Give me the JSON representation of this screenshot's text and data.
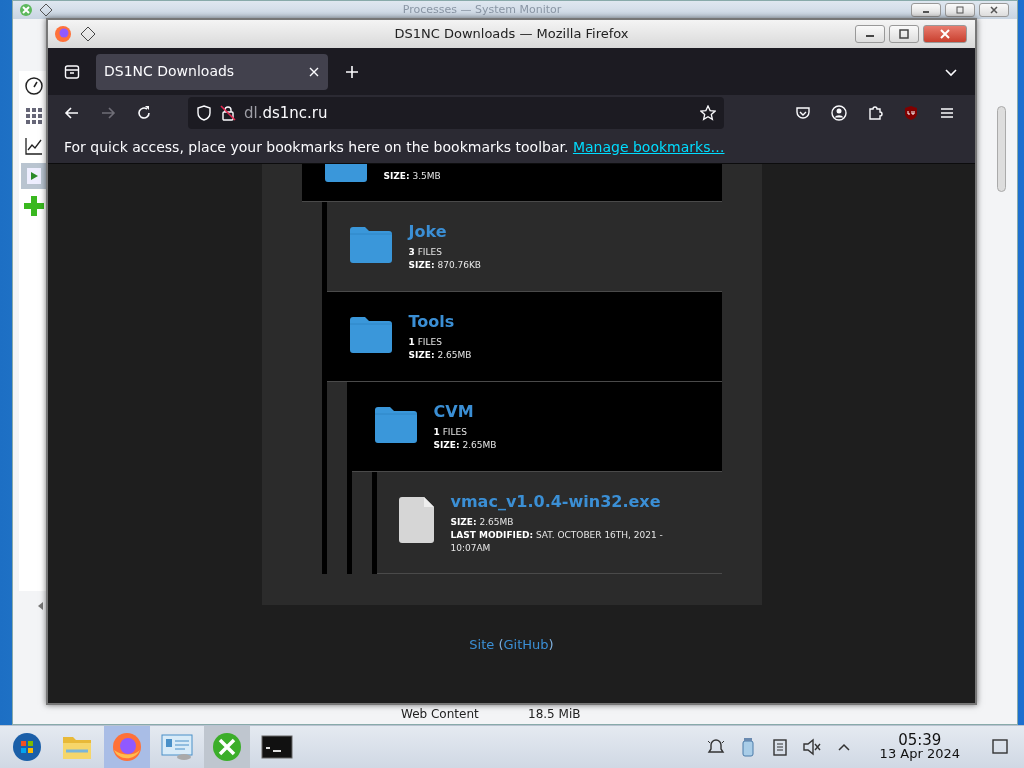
{
  "background_window": {
    "title": "Processes — System Monitor",
    "sidebar": [
      {
        "kind": "gauge",
        "selected": false
      },
      {
        "kind": "apps",
        "selected": false
      },
      {
        "kind": "chart",
        "selected": false
      },
      {
        "kind": "play",
        "selected": true
      },
      {
        "kind": "add",
        "selected": false
      }
    ],
    "visible_row": [
      "Web Content",
      "18.5 MiB"
    ]
  },
  "browser": {
    "title": "DS1NC Downloads — Mozilla Firefox",
    "tabs": [
      {
        "label": "DS1NC Downloads",
        "selected": true
      }
    ],
    "nav_buttons": [
      {
        "kind": "back",
        "disabled": false
      },
      {
        "kind": "forward",
        "disabled": true
      },
      {
        "kind": "reload",
        "disabled": false
      }
    ],
    "address": {
      "dim": "dl.",
      "main": "ds1nc.ru"
    },
    "bookmarks_hint": {
      "text": "For quick access, place your bookmarks here on the bookmarks toolbar.",
      "link": "Manage bookmarks…"
    }
  },
  "tree": [
    {
      "kind": "folder",
      "highlighted": false,
      "size": "**SIZE:** 3.5MB",
      "children": [
        {
          "kind": "folder",
          "highlighted": true,
          "name": "Joke",
          "files": "**3** FILES",
          "size": "**SIZE:** 870.76KB"
        },
        {
          "kind": "folder",
          "highlighted": false,
          "name": "Tools",
          "files": "**1** FILES",
          "size": "**SIZE:** 2.65MB",
          "children": [
            {
              "kind": "folder",
              "highlighted": false,
              "name": "CVM",
              "files": "**1** FILES",
              "size": "**SIZE:** 2.65MB",
              "children": [
                {
                  "kind": "file",
                  "highlighted": true,
                  "name": "vmac_v1.0.4-win32.exe",
                  "size": "**SIZE:** 2.65MB",
                  "modified": "**LAST MODIFIED:** SAT. OCTOBER 16TH, 2021 - 10:07AM"
                }
              ]
            }
          ]
        }
      ]
    }
  ],
  "footer": {
    "link": "Site",
    "open": " (",
    "link2": "GitHub",
    "close": ")"
  },
  "taskbar": {
    "apps": [
      {
        "kind": "start",
        "active": false
      },
      {
        "kind": "files",
        "active": false
      },
      {
        "kind": "firefox",
        "active": true
      },
      {
        "kind": "settings",
        "active": false
      },
      {
        "kind": "tools",
        "active": true
      },
      {
        "kind": "terminal",
        "active": false
      }
    ],
    "clock": {
      "time": "05:39",
      "date": "13 Apr 2024"
    }
  }
}
